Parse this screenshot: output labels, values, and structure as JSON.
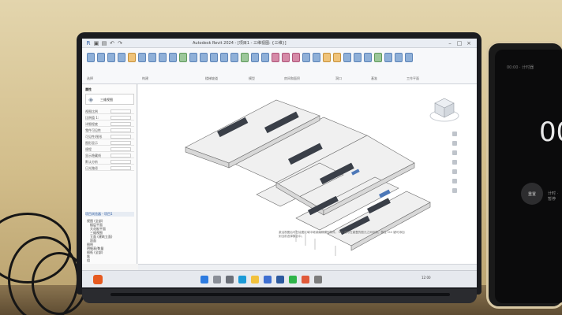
{
  "scene": {
    "phone_time": "00",
    "phone_topline": "00:00 · 计时器",
    "phone_left_btn": "重置",
    "phone_right_label": "计时 · 暂停"
  },
  "app": {
    "title": "Autodesk Revit 2024 - [项目1 - 三维视图: {三维}]",
    "ribbon_groups": [
      "选择",
      "构建",
      "楼梯坡道",
      "模型",
      "房间和面积",
      "洞口",
      "基准",
      "工作平面"
    ],
    "properties_header": "属性",
    "type_name": "三维视图",
    "prop_rows": [
      {
        "label": "视图比例"
      },
      {
        "label": "比例值 1:"
      },
      {
        "label": "详细程度"
      },
      {
        "label": "零件可见性"
      },
      {
        "label": "可见性/图形"
      },
      {
        "label": "图形显示"
      },
      {
        "label": "规程"
      },
      {
        "label": "显示隐藏线"
      },
      {
        "label": "默认分析"
      },
      {
        "label": "日光路径"
      }
    ],
    "browser_header": "项目浏览器 - 项目1",
    "tree": [
      "视图 (全部)",
      "楼层平面",
      "天花板平面",
      "三维视图",
      "立面 (建筑立面)",
      "剖面",
      "图例",
      "明细表/数量",
      "图纸 (全部)",
      "族",
      "组",
      "Revit 链接"
    ],
    "note_text": "激活视图后可在绘图区域中继续编辑模型构件，Tab 键可在重叠的图元之间切换，按住 Ctrl 键可添加到当前选择集合中。",
    "tray_time": "12:00"
  },
  "colors": {
    "accent": "#2c5aa0",
    "start": "#e65a20"
  }
}
